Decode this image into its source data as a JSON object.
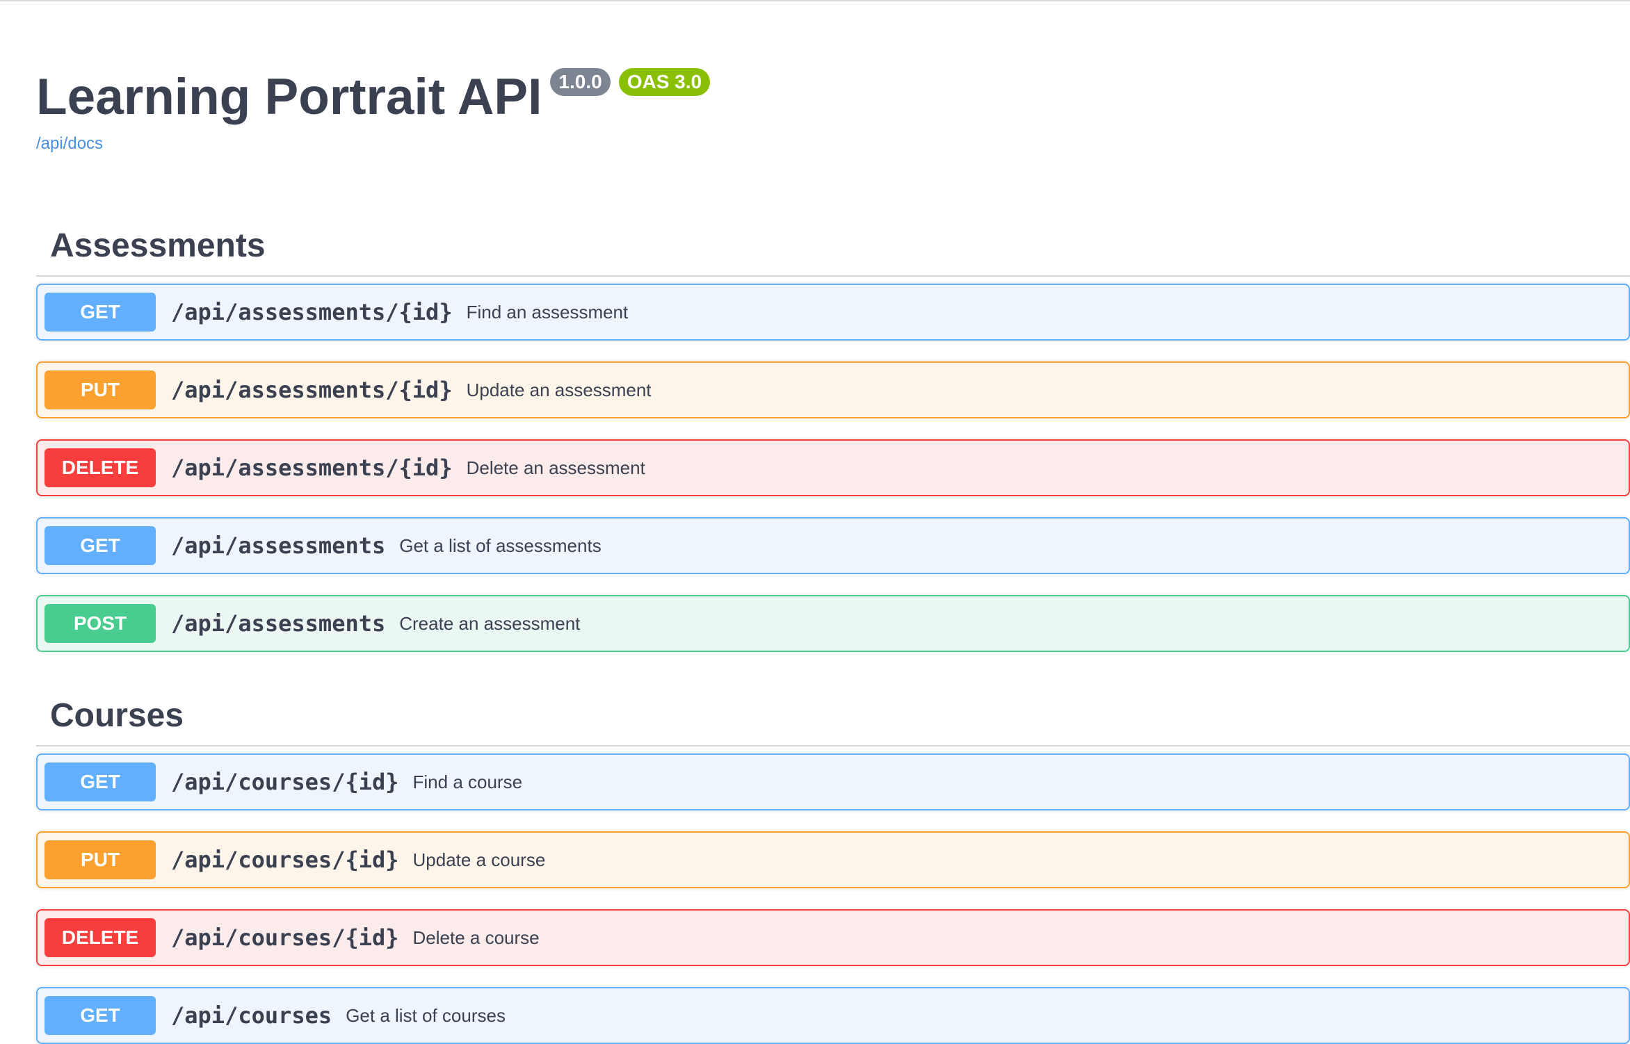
{
  "info": {
    "title": "Learning Portrait API",
    "version": "1.0.0",
    "oas": "OAS 3.0",
    "docs_link": "/api/docs"
  },
  "colors": {
    "get": "#61affe",
    "put": "#fca130",
    "delete": "#f93e3e",
    "post": "#49cc90",
    "version_badge": "#7d8492",
    "oas_badge": "#89bf04",
    "link": "#4990e2"
  },
  "tags": [
    {
      "name": "Assessments",
      "operations": [
        {
          "method": "GET",
          "path": "/api/assessments/{id}",
          "summary": "Find an assessment"
        },
        {
          "method": "PUT",
          "path": "/api/assessments/{id}",
          "summary": "Update an assessment"
        },
        {
          "method": "DELETE",
          "path": "/api/assessments/{id}",
          "summary": "Delete an assessment"
        },
        {
          "method": "GET",
          "path": "/api/assessments",
          "summary": "Get a list of assessments"
        },
        {
          "method": "POST",
          "path": "/api/assessments",
          "summary": "Create an assessment"
        }
      ]
    },
    {
      "name": "Courses",
      "operations": [
        {
          "method": "GET",
          "path": "/api/courses/{id}",
          "summary": "Find a course"
        },
        {
          "method": "PUT",
          "path": "/api/courses/{id}",
          "summary": "Update a course"
        },
        {
          "method": "DELETE",
          "path": "/api/courses/{id}",
          "summary": "Delete a course"
        },
        {
          "method": "GET",
          "path": "/api/courses",
          "summary": "Get a list of courses"
        }
      ]
    }
  ]
}
